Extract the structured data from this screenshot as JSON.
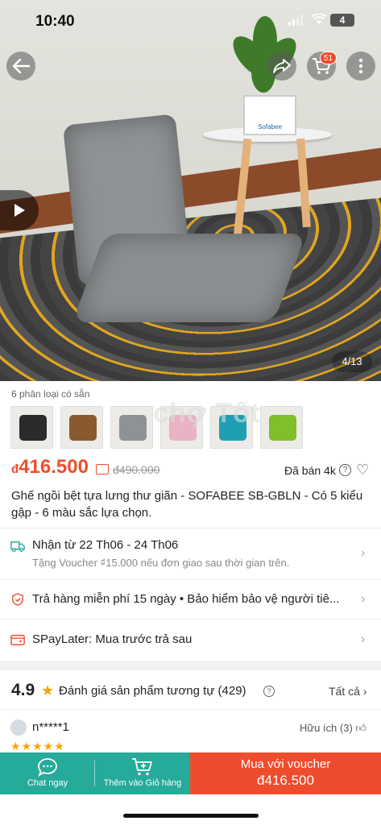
{
  "status_bar": {
    "time": "10:40",
    "battery": "4"
  },
  "header": {
    "cart_count": "51"
  },
  "gallery": {
    "counter": "4/13",
    "frame_text": "Sofabee"
  },
  "variants": {
    "label": "6 phân loại có sẵn",
    "colors": [
      "#2b2b2e",
      "#8a5a2f",
      "#8f9294",
      "#e9b3c4",
      "#1f9fb3",
      "#7fbf2a"
    ]
  },
  "watermark": "chợ Tốt",
  "price": {
    "currency": "đ",
    "current": "416.500",
    "original": "đ490.000",
    "sold": "Đã bán 4k"
  },
  "product": {
    "title": "Ghế ngồi bệt tựa lưng thư giãn - SOFABEE SB-GBLN - Có 5 kiểu gập - 6 màu sắc lựa chọn."
  },
  "shipping": {
    "label": "Nhận từ 22 Th06 - 24 Th06",
    "sub": "Tặng Voucher ₫15.000 nếu đơn giao sau thời gian trên."
  },
  "guarantee": {
    "label": "Trả hàng miễn phí 15 ngày  •  Bảo hiểm bảo vệ người tiê..."
  },
  "spaylater": {
    "label": "SPayLater: Mua trước trả sau"
  },
  "reviews": {
    "score": "4.9",
    "label": "Đánh giá sản phẩm tương tự (429)",
    "see_all": "Tất cả",
    "reviewer": "n*****1",
    "helpful": "Hữu ích (3)",
    "stars": "★★★★★"
  },
  "bottom_bar": {
    "chat": "Chat ngay",
    "add_cart": "Thêm vào Giỏ hàng",
    "buy_line1": "Mua với voucher",
    "buy_line2": "đ416.500"
  },
  "colors": {
    "accent": "#ee4d2d",
    "teal": "#26aa99",
    "star": "#f6a700"
  }
}
